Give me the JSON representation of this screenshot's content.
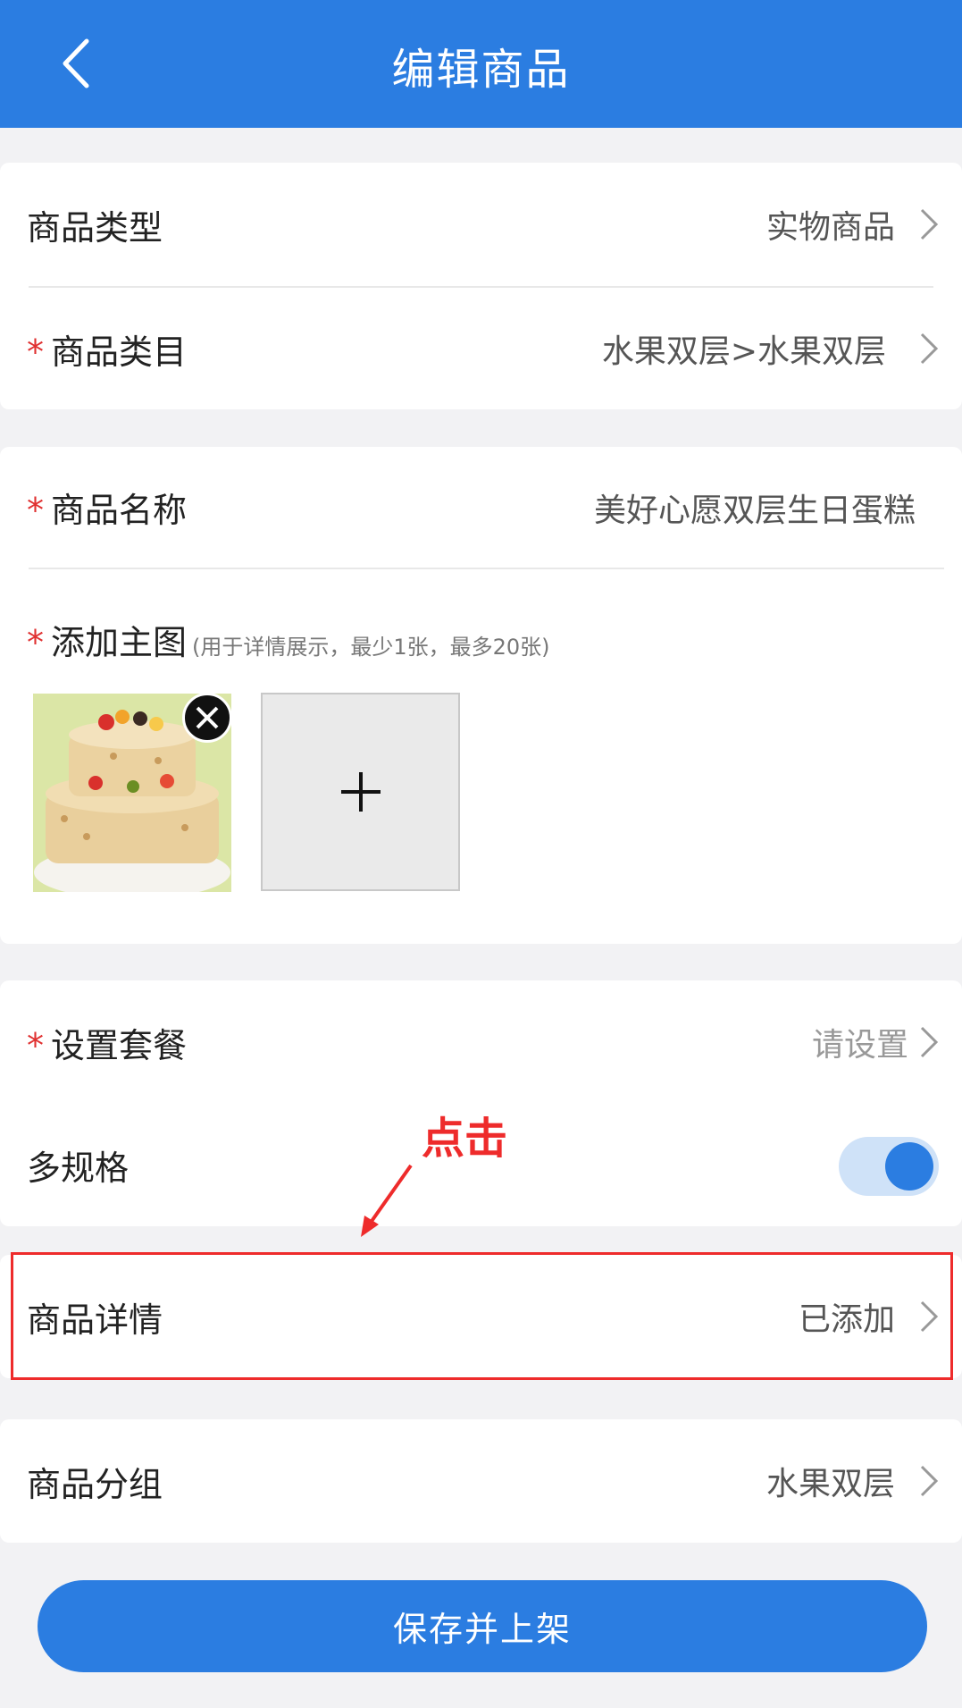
{
  "header": {
    "title": "编辑商品"
  },
  "product_type": {
    "label": "商品类型",
    "value": "实物商品"
  },
  "category": {
    "required_mark": "*",
    "label": "商品类目",
    "value": "水果双层>水果双层"
  },
  "name": {
    "required_mark": "*",
    "label": "商品名称",
    "value": "美好心愿双层生日蛋糕"
  },
  "main_image": {
    "required_mark": "*",
    "label": "添加主图",
    "hint": "(用于详情展示，最少1张，最多20张)",
    "add_symbol": "+"
  },
  "package": {
    "required_mark": "*",
    "label": "设置套餐",
    "value": "请设置"
  },
  "multi_spec": {
    "label": "多规格",
    "enabled": true
  },
  "annotation": {
    "text": "点击"
  },
  "details": {
    "label": "商品详情",
    "value": "已添加"
  },
  "group": {
    "label": "商品分组",
    "value": "水果双层"
  },
  "save_button": {
    "label": "保存并上架"
  },
  "colors": {
    "primary": "#2b7de1",
    "required": "#e03131",
    "annotation": "#ee2b2b"
  }
}
